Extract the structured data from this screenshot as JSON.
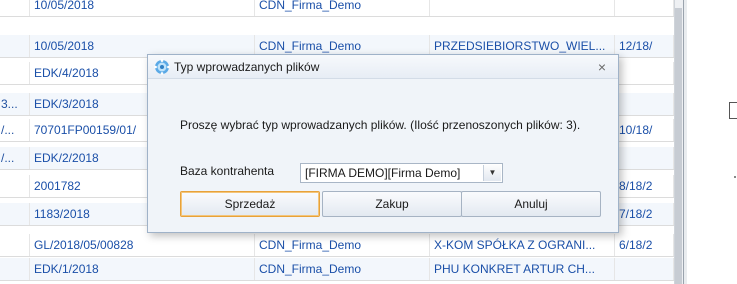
{
  "grid": {
    "rows": [
      {
        "c0": "",
        "c1": "10/05/2018",
        "c2": "CDN_Firma_Demo",
        "c3": "",
        "c4": ""
      },
      {
        "c0": "",
        "c1": "10/05/2018",
        "c2": "CDN_Firma_Demo",
        "c3": "PRZEDSIEBIORSTWO_WIEL...",
        "c4": "12/18/"
      },
      {
        "c0": "",
        "c1": "EDK/4/2018",
        "c2": "",
        "c3": "",
        "c4": ""
      },
      {
        "c0": "3...",
        "c1": "EDK/3/2018",
        "c2": "",
        "c3": "",
        "c4": ""
      },
      {
        "c0": "/...",
        "c1": "70701FP00159/01/",
        "c2": "",
        "c3": "",
        "c4": "10/18/"
      },
      {
        "c0": "/...",
        "c1": "EDK/2/2018",
        "c2": "",
        "c3": "",
        "c4": ""
      },
      {
        "c0": "",
        "c1": "2001782",
        "c2": "",
        "c3": "",
        "c4": "8/18/2"
      },
      {
        "c0": "",
        "c1": "1183/2018",
        "c2": "",
        "c3": "",
        "c4": "7/18/2"
      },
      {
        "c0": "",
        "c1": "GL/2018/05/00828",
        "c2": "CDN_Firma_Demo",
        "c3": "X-KOM SPÓŁKA Z OGRANI...",
        "c4": "6/18/2"
      },
      {
        "c0": "",
        "c1": "EDK/1/2018",
        "c2": "CDN_Firma_Demo",
        "c3": "PHU KONKRET ARTUR CH...",
        "c4": ""
      }
    ]
  },
  "dialog": {
    "title": "Typ wprowadzanych plików",
    "close_label": "×",
    "message": "Proszę wybrać typ wprowadzanych plików. (Ilość przenoszonych plików: 3).",
    "field_label": "Baza kontrahenta",
    "combo_value": "[FIRMA DEMO][Firma Demo]",
    "combo_arrow": "▼",
    "buttons": {
      "sales": "Sprzedaż",
      "purchase": "Zakup",
      "cancel": "Anuluj"
    }
  },
  "icons": {
    "title_icon": "gear-spinner-icon",
    "dropdown": "chevron-down-icon",
    "close": "close-icon"
  },
  "colors": {
    "link_text": "#1a4fa8",
    "primary_button_border": "#e8a23a",
    "dialog_bg": "#f0f4f9"
  }
}
